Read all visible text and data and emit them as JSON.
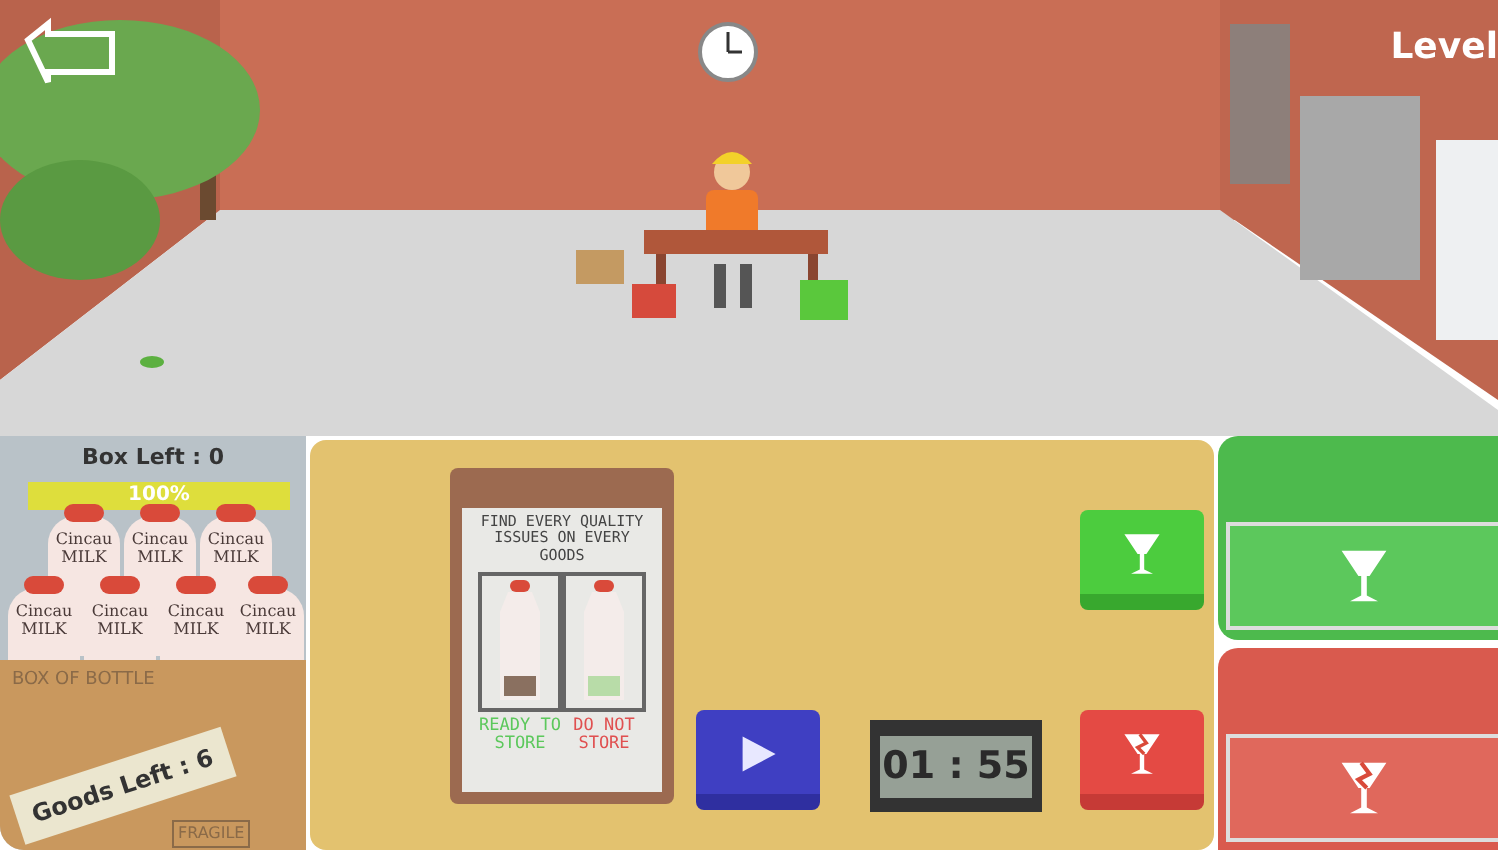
{
  "level_label": "Level",
  "box_panel": {
    "box_left": "Box Left : 0",
    "progress": {
      "level": 1,
      "reading": "100%"
    },
    "bottles": [
      {
        "brand": "Cincau",
        "product": "MILK"
      },
      {
        "brand": "Cincau",
        "product": "MILK"
      },
      {
        "brand": "Cincau",
        "product": "MILK"
      },
      {
        "brand": "Cincau",
        "product": "MILK"
      },
      {
        "brand": "Cincau",
        "product": "MILK"
      },
      {
        "brand": "Cincau",
        "product": "MILK"
      },
      {
        "brand": "Cincau",
        "product": "MILK"
      }
    ],
    "box_print": "BOX OF BOTTLE",
    "goods_left": "Goods Left : 6",
    "fragile": "FRAGILE"
  },
  "instruction_board": {
    "title": "FIND EVERY QUALITY ISSUES ON EVERY GOODS",
    "examples": [
      {
        "kind": "good",
        "caption": "READY TO STORE"
      },
      {
        "kind": "bad",
        "caption": "DO NOT STORE"
      }
    ]
  },
  "timer": "01 : 55"
}
